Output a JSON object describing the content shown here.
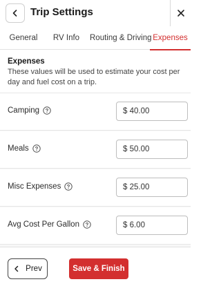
{
  "header": {
    "title": "Trip Settings"
  },
  "tabs": [
    {
      "label": "General",
      "active": false
    },
    {
      "label": "RV Info",
      "active": false
    },
    {
      "label": "Routing & Driving",
      "active": false
    },
    {
      "label": "Expenses",
      "active": true
    }
  ],
  "section": {
    "title": "Expenses",
    "description": "These values will be used to estimate your cost per day and fuel cost on a trip."
  },
  "rows": [
    {
      "label": "Camping",
      "value": "$ 40.00"
    },
    {
      "label": "Meals",
      "value": "$ 50.00"
    },
    {
      "label": "Misc Expenses",
      "value": "$ 25.00"
    },
    {
      "label": "Avg Cost Per Gallon",
      "value": "$ 6.00"
    }
  ],
  "footer": {
    "prev_label": "Prev",
    "save_label": "Save & Finish"
  },
  "icons": {
    "back": "chevron-left-icon",
    "close": "close-icon",
    "help": "help-circle-icon"
  },
  "colors": {
    "accent": "#d32f2f"
  }
}
